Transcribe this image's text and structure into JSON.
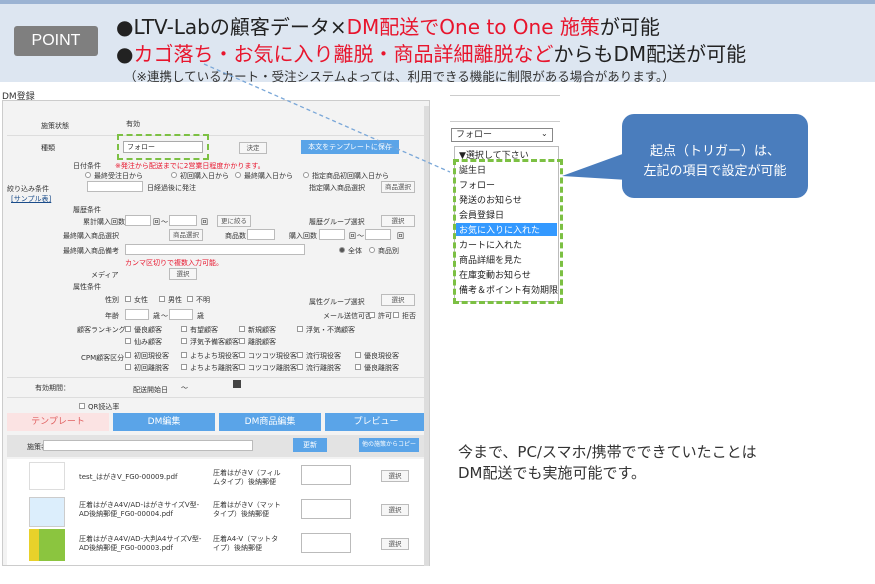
{
  "banner": {
    "badge": "POINT",
    "line1_a": "●LTV-Labの顧客データ×",
    "line1_b": "DM配送でOne to One 施策",
    "line1_c": "が可能",
    "line2_a": "●",
    "line2_b": "カゴ落ち・お気に入り離脱・商品詳細離脱など",
    "line2_c": "からもDM配送が可能",
    "line3": "（※連携しているカート・受注システムよっては、利用できる機能に制限がある場合があります。）"
  },
  "dm": {
    "title": "DM登録",
    "status_label": "施策状態",
    "status_value": "有効",
    "type_label": "種類",
    "type_value": "フォロー",
    "type_btn": "決定",
    "save_tpl_btn": "本文をテンプレートに保存",
    "date_cond": "日付条件",
    "date_note": "※発注から配送までに2営業日程度かかります。",
    "r1": "最終受注日から",
    "r2": "初回購入日から",
    "r3": "最終購入日から",
    "r4": "指定商品初回購入日から",
    "ago_before": "日経過後に発注",
    "spec_item": "指定購入商品選択",
    "item_select": "商品選択",
    "filter_label": "絞り込み条件",
    "sample": "[サンプル表]",
    "history": "履歴条件",
    "purchase_count": "累計購入回数",
    "times": "回",
    "tilde": "〜",
    "narrow_btn": "更に絞る",
    "group_sel": "履歴グループ選択",
    "select": "選択",
    "last_item": "最終購入商品選択",
    "item_btn": "商品選択",
    "item_count": "商品数",
    "buy_count": "購入回数",
    "last_item_remark": "最終購入商品備考",
    "all": "全体",
    "per_item": "商品別",
    "comma_note": "カンマ区切りで複数入力可能。",
    "media": "メディア",
    "attr": "属性条件",
    "gender": "性別",
    "female": "女性",
    "male": "男性",
    "unknown": "不明",
    "attr_group": "属性グループ選択",
    "age": "年齢",
    "years": "歳",
    "mail": "メール送信可否",
    "allow": "許可",
    "deny": "拒否",
    "rank": "顧客ランキング",
    "rank_items": [
      "優良顧客",
      "有望顧客",
      "新規顧客",
      "浮気・不満顧客",
      "仙み顧客",
      "浮気予備客顧客",
      "離脱顧客"
    ],
    "cpm": "CPM顧客区分",
    "cpm_items": [
      "初回現役客",
      "よちよち現役客",
      "コツコツ現役客",
      "流行現役客",
      "優良現役客",
      "初回離脱客",
      "よちよち離脱客",
      "コツコツ離脱客",
      "流行離脱客",
      "優良離脱客"
    ],
    "valid_period": "有効期間：",
    "delivery_date": "配送開始日",
    "qr": "QR読込率",
    "tabs": [
      "テンプレート",
      "DM編集",
      "DM商品編集",
      "プレビュー"
    ],
    "name_label": "施策名",
    "update_btn": "更新",
    "copy_btn": "他の施策からコピー",
    "files": [
      {
        "name": "test_はがきV_FG0-00009.pdf",
        "desc": "圧着はがきV（フィルムタイプ）後納郵便",
        "btn": "選択"
      },
      {
        "name": "圧着はがきA4V/AD-はがきサイズV型-AD後納郵便_FG0-00004.pdf",
        "desc": "圧着はがきV（マットタイプ）後納郵便",
        "btn": "選択"
      },
      {
        "name": "圧着はがきA4V/AD-大判A4サイズV型-AD後納郵便_FG0-00003.pdf",
        "desc": "圧着A4-V（マットタイプ）後納郵便",
        "btn": "選択"
      }
    ]
  },
  "dropdown": {
    "value": "フォロー",
    "items": [
      "▼選択して下さい",
      "誕生日",
      "フォロー",
      "発送のお知らせ",
      "会員登録日",
      "お気に入りに入れた",
      "カートに入れた",
      "商品詳細を見た",
      "在庫変動お知らせ",
      "備考＆ポイント有効期限"
    ],
    "selected_index": 5
  },
  "callout": {
    "line1": "起点（トリガー）は、",
    "line2": "左記の項目で設定が可能"
  },
  "note": {
    "line1": "今まで、PC/スマホ/携帯でできていたことは",
    "line2": "DM配送でも実施可能です。"
  },
  "colors": {
    "accent_red": "#e8152d",
    "callout_blue": "#4a7dbd",
    "dash_green": "#7cc043",
    "tab_blue": "#5aa4e8"
  }
}
